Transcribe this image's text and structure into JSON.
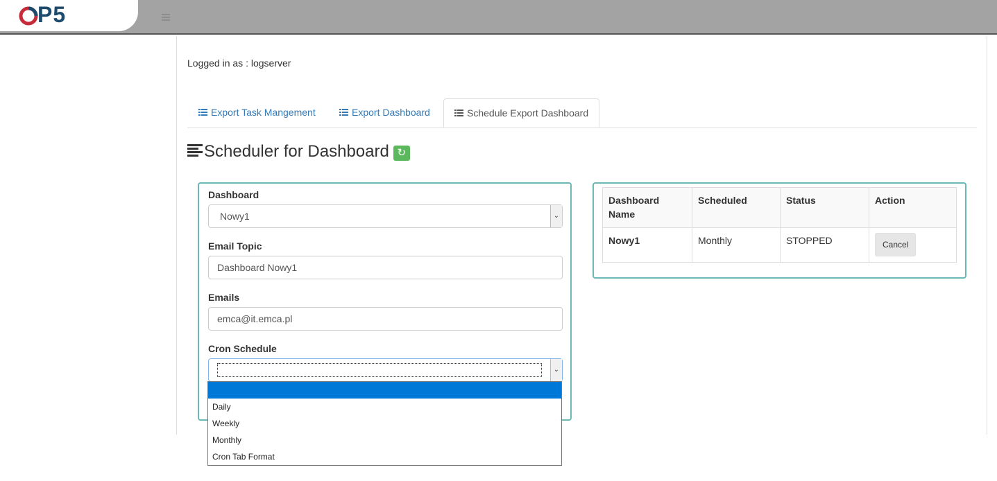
{
  "brand": {
    "logo_text": "P5"
  },
  "session": {
    "logged_in_text": "Logged in as : logserver"
  },
  "tabs": [
    {
      "label": "Export Task Mangement",
      "active": false
    },
    {
      "label": "Export Dashboard",
      "active": false
    },
    {
      "label": "Schedule Export Dashboard",
      "active": true
    }
  ],
  "page": {
    "title": "Scheduler for Dashboard"
  },
  "form": {
    "dashboard_label": "Dashboard",
    "dashboard_value": "Nowy1",
    "email_topic_label": "Email Topic",
    "email_topic_value": "Dashboard Nowy1",
    "emails_label": "Emails",
    "emails_value": "emca@it.emca.pl",
    "cron_label": "Cron Schedule",
    "cron_value": "",
    "cron_options": [
      "",
      "Daily",
      "Weekly",
      "Monthly",
      "Cron Tab Format"
    ]
  },
  "table": {
    "headers": [
      "Dashboard Name",
      "Scheduled",
      "Status",
      "Action"
    ],
    "rows": [
      {
        "name": "Nowy1",
        "scheduled": "Monthly",
        "status": "STOPPED",
        "action": "Cancel"
      }
    ]
  },
  "colors": {
    "accent": "#337ab7",
    "panel_border": "#6cb8b6",
    "refresh_green": "#5cb85c",
    "dropdown_selected": "#0078d7"
  },
  "icons": [
    "menu-icon",
    "list-icon",
    "refresh-icon",
    "chevron-down-icon"
  ]
}
